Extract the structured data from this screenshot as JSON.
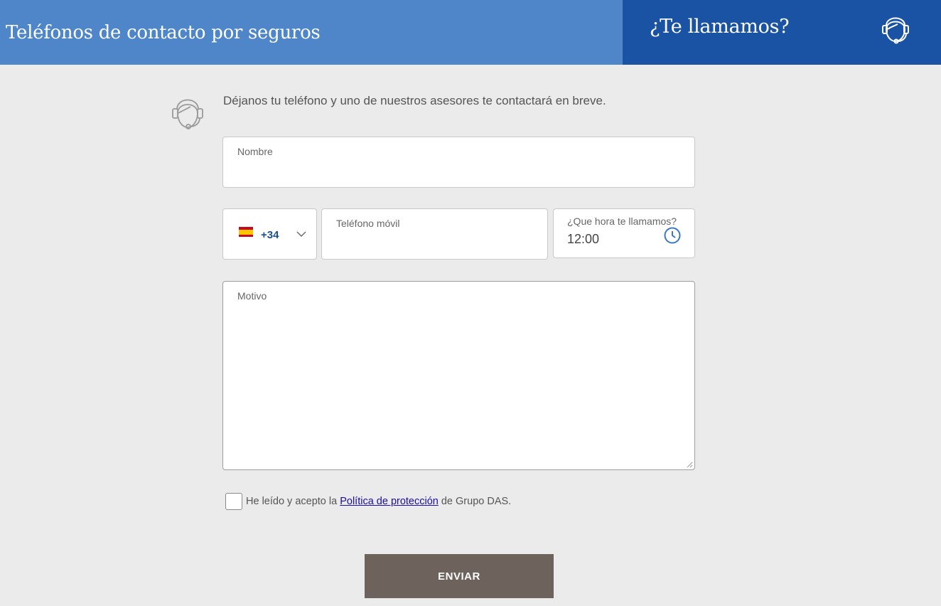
{
  "header": {
    "title": "Teléfonos de contacto por seguros",
    "callback_title": "¿Te llamamos?",
    "icon": "headset-agent-icon",
    "colors": {
      "left": "#4e86c9",
      "right": "#1b53a4"
    }
  },
  "form": {
    "intro": "Déjanos tu teléfono y uno de nuestros asesores te contactará en breve.",
    "name_label": "Nombre",
    "country": {
      "flag": "spain-flag-icon",
      "code": "+34"
    },
    "phone_label": "Teléfono móvil",
    "time_label": "¿Que hora te llamamos?",
    "time_value": "12:00",
    "reason_label": "Motivo",
    "consent": {
      "before": "He leído y acepto la ",
      "link": "Política de protección",
      "after": " de Grupo DAS."
    },
    "submit_label": "ENVIAR",
    "submit_color": "#6d625c"
  }
}
